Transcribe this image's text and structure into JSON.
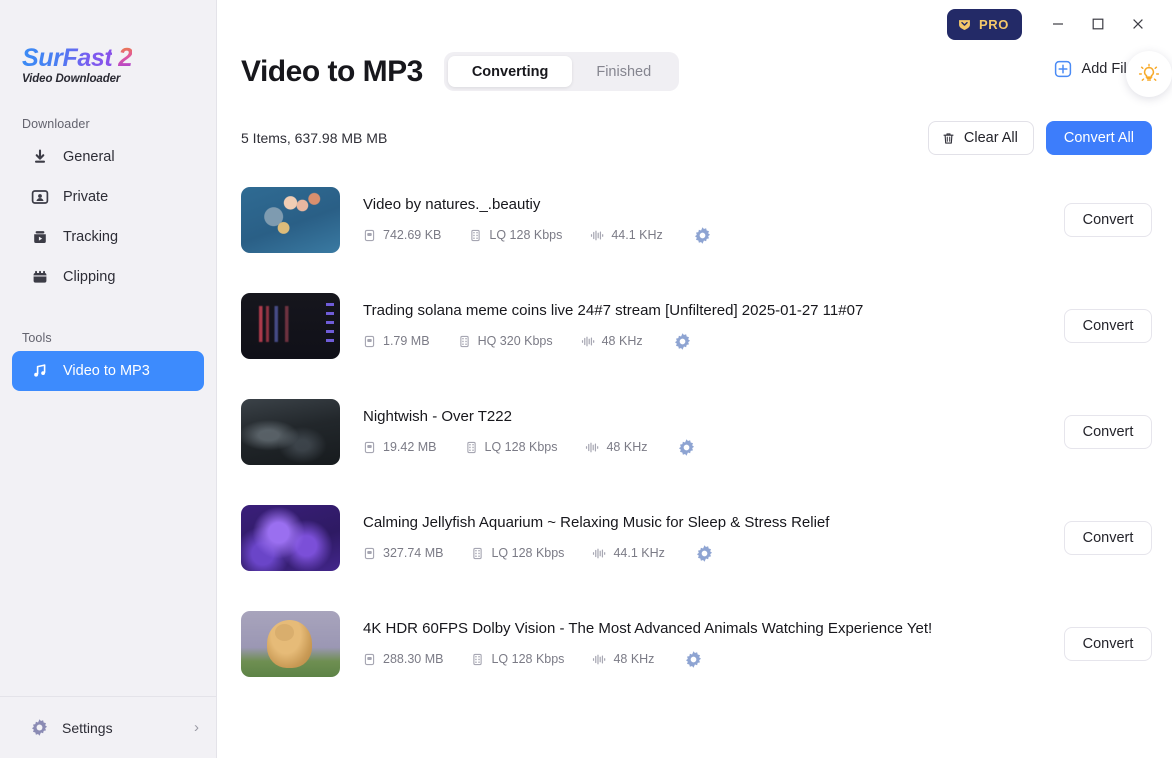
{
  "window": {
    "pro_label": "PRO",
    "minimize_label": "–",
    "maximize_label": "□",
    "close_label": "×"
  },
  "sidebar": {
    "logo": {
      "brand_part1": "SurFast",
      "brand_part2": "2",
      "tagline": "Video Downloader"
    },
    "sections": [
      {
        "label": "Downloader",
        "items": [
          {
            "label": "General",
            "icon": "download-arrow-icon",
            "active": false
          },
          {
            "label": "Private",
            "icon": "private-person-icon",
            "active": false
          },
          {
            "label": "Tracking",
            "icon": "tracking-video-icon",
            "active": false
          },
          {
            "label": "Clipping",
            "icon": "clipping-film-icon",
            "active": false
          }
        ]
      },
      {
        "label": "Tools",
        "items": [
          {
            "label": "Video to MP3",
            "icon": "music-note-icon",
            "active": true
          }
        ]
      }
    ],
    "settings": {
      "label": "Settings",
      "icon": "gear-icon",
      "chevron": "›"
    }
  },
  "header": {
    "title": "Video to MP3",
    "tabs": [
      {
        "label": "Converting",
        "active": true
      },
      {
        "label": "Finished",
        "active": false
      }
    ],
    "add_files_label": "Add Files",
    "tip_icon": "lightbulb-icon"
  },
  "toolbar": {
    "items_summary": "5 Items, 637.98 MB MB",
    "clear_all_label": "Clear All",
    "convert_all_label": "Convert All"
  },
  "list": {
    "convert_label": "Convert",
    "rows": [
      {
        "title": "Video by natures._.beautiy",
        "size": "742.69 KB",
        "bitrate": "LQ 128 Kbps",
        "samplerate": "44.1 KHz",
        "thumb_class": "t1"
      },
      {
        "title": "Trading solana meme coins live 24#7 stream [Unfiltered] 2025-01-27 11#07",
        "size": "1.79 MB",
        "bitrate": "HQ 320 Kbps",
        "samplerate": "48 KHz",
        "thumb_class": "t2"
      },
      {
        "title": "Nightwish - Over T222",
        "size": "19.42 MB",
        "bitrate": "LQ 128 Kbps",
        "samplerate": "48 KHz",
        "thumb_class": "t3"
      },
      {
        "title": "Calming Jellyfish Aquarium ~ Relaxing Music for Sleep & Stress Relief",
        "size": "327.74 MB",
        "bitrate": "LQ 128 Kbps",
        "samplerate": "44.1 KHz",
        "thumb_class": "t4"
      },
      {
        "title": "4K HDR 60FPS Dolby Vision - The Most Advanced Animals Watching Experience Yet!",
        "size": "288.30 MB",
        "bitrate": "LQ 128 Kbps",
        "samplerate": "48 KHz",
        "thumb_class": "t5"
      }
    ]
  },
  "colors": {
    "accent_blue": "#3d7dfb",
    "sidebar_bg": "#f2f1f5",
    "pro_navy": "#232a67",
    "pro_gold": "#f4c86a",
    "gear_blue": "#8ea4d2",
    "bulb_orange": "#f7a928"
  }
}
